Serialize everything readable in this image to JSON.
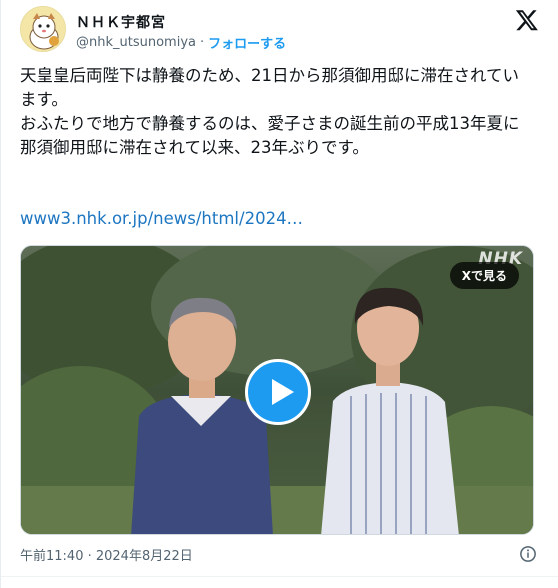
{
  "account": {
    "display_name": "ＮＨＫ宇都宮",
    "handle": "@nhk_utsunomiya",
    "separator": "·",
    "follow_label": "フォローする"
  },
  "tweet": {
    "paragraph1": "天皇皇后両陛下は静養のため、21日から那須御用邸に滞在されています。",
    "paragraph2": "おふたりで地方で静養するのは、愛子さまの誕生前の平成13年夏に那須御用邸に滞在されて以来、23年ぶりです。",
    "link_text": "www3.nhk.or.jp/news/html/2024…",
    "timestamp": "午前11:40 · 2024年8月22日"
  },
  "media": {
    "watermark": "NHK",
    "view_on_x_label": "Xで見る"
  },
  "icons": {
    "brand": "x-logo-icon",
    "play": "play-icon",
    "info": "info-icon"
  },
  "colors": {
    "accent": "#1d9bf0",
    "link": "#1d76c1",
    "muted": "#536471"
  }
}
